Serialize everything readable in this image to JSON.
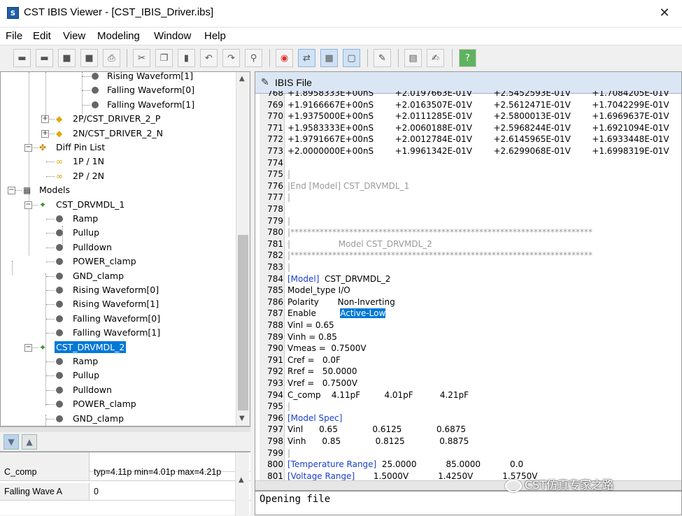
{
  "window": {
    "title": "CST IBIS Viewer - [CST_IBIS_Driver.ibs]",
    "icon_label": "S",
    "close_glyph": "✕"
  },
  "menu": [
    "File",
    "Edit",
    "View",
    "Modeling",
    "Window",
    "Help"
  ],
  "toolbar": {
    "buttons": [
      {
        "name": "open-folder-icon",
        "glyph": "▬"
      },
      {
        "name": "folder-icon",
        "glyph": "▬"
      },
      {
        "name": "save-icon",
        "glyph": "■"
      },
      {
        "name": "save-all-icon",
        "glyph": "■"
      },
      {
        "name": "print-icon",
        "glyph": "⎙"
      },
      {
        "name": "cut-icon",
        "glyph": "✂"
      },
      {
        "name": "copy-icon",
        "glyph": "❐"
      },
      {
        "name": "paste-icon",
        "glyph": "▮"
      },
      {
        "name": "undo-icon",
        "glyph": "↶"
      },
      {
        "name": "redo-icon",
        "glyph": "↷"
      },
      {
        "name": "find-icon",
        "glyph": "⚲"
      },
      {
        "name": "color-wheel-icon",
        "glyph": "◉"
      },
      {
        "name": "sync-icon",
        "glyph": "⇄"
      },
      {
        "name": "grid-icon",
        "glyph": "▦"
      },
      {
        "name": "frame-icon",
        "glyph": "▢"
      },
      {
        "name": "tool-icon",
        "glyph": "✎"
      },
      {
        "name": "table-icon",
        "glyph": "▤"
      },
      {
        "name": "edit-icon",
        "glyph": "✍"
      },
      {
        "name": "help-icon",
        "glyph": "?"
      }
    ]
  },
  "tree": {
    "items": [
      {
        "label": "Rising Waveform[1]",
        "icon": "dot"
      },
      {
        "label": "Falling Waveform[0]",
        "icon": "dot"
      },
      {
        "label": "Falling Waveform[1]",
        "icon": "dot"
      },
      {
        "label": "2P/CST_DRIVER_2_P",
        "icon": "pin",
        "expander": "+"
      },
      {
        "label": "2N/CST_DRIVER_2_N",
        "icon": "pin",
        "expander": "+"
      },
      {
        "label": "Diff Pin List",
        "icon": "diff",
        "expander": "−"
      },
      {
        "label": "1P / 1N",
        "icon": "pair"
      },
      {
        "label": "2P / 2N",
        "icon": "pair"
      },
      {
        "label": "Models",
        "icon": "models",
        "expander": "−"
      },
      {
        "label": "CST_DRVMDL_1",
        "icon": "model",
        "expander": "−"
      },
      {
        "label": "Ramp",
        "icon": "dot"
      },
      {
        "label": "Pullup",
        "icon": "dot"
      },
      {
        "label": "Pulldown",
        "icon": "dot"
      },
      {
        "label": "POWER_clamp",
        "icon": "dot"
      },
      {
        "label": "GND_clamp",
        "icon": "dot"
      },
      {
        "label": "Rising Waveform[0]",
        "icon": "dot"
      },
      {
        "label": "Rising Waveform[1]",
        "icon": "dot"
      },
      {
        "label": "Falling Waveform[0]",
        "icon": "dot"
      },
      {
        "label": "Falling Waveform[1]",
        "icon": "dot"
      },
      {
        "label": "CST_DRVMDL_2",
        "icon": "model",
        "expander": "−",
        "selected": true
      },
      {
        "label": "Ramp",
        "icon": "dot"
      },
      {
        "label": "Pullup",
        "icon": "dot"
      },
      {
        "label": "Pulldown",
        "icon": "dot"
      },
      {
        "label": "POWER_clamp",
        "icon": "dot"
      },
      {
        "label": "GND_clamp",
        "icon": "dot"
      }
    ],
    "scroll_up": "▲",
    "scroll_down": "▼"
  },
  "properties": {
    "sort_desc": "▼",
    "sort_asc": "▲",
    "rows": [
      {
        "name": "",
        "value": ""
      },
      {
        "name": "C_comp",
        "value": "typ=4.11p min=4.01p max=4.21p"
      },
      {
        "name": "Falling Wave A",
        "value": "0"
      }
    ]
  },
  "ibis_file": {
    "tab_label": "IBIS File",
    "tab_icon": "✎",
    "lines": [
      {
        "n": "768",
        "t": "+1.8958333E+00nS        +2.0197663E-01V        +2.5452593E-01V        +1.7084205E-01V"
      },
      {
        "n": "769",
        "t": "+1.9166667E+00nS        +2.0163507E-01V        +2.5612471E-01V        +1.7042299E-01V"
      },
      {
        "n": "770",
        "t": "+1.9375000E+00nS        +2.0111285E-01V        +2.5800013E-01V        +1.6969637E-01V"
      },
      {
        "n": "771",
        "t": "+1.9583333E+00nS        +2.0060188E-01V        +2.5968244E-01V        +1.6921094E-01V"
      },
      {
        "n": "772",
        "t": "+1.9791667E+00nS        +2.0012784E-01V        +2.6145965E-01V        +1.6933448E-01V"
      },
      {
        "n": "773",
        "t": "+2.0000000E+00nS        +1.9961342E-01V        +2.6299068E-01V        +1.6998319E-01V"
      },
      {
        "n": "774",
        "t": ""
      },
      {
        "n": "775",
        "t": "|",
        "style": "gray"
      },
      {
        "n": "776",
        "t": "|End [Model] CST_DRVMDL_1",
        "style": "gray"
      },
      {
        "n": "777",
        "t": "|",
        "style": "gray"
      },
      {
        "n": "778",
        "t": ""
      },
      {
        "n": "779",
        "t": "|",
        "style": "gray"
      },
      {
        "n": "780",
        "t": "|************************************************************************",
        "style": "gray"
      },
      {
        "n": "781",
        "t": "|                  Model CST_DRVMDL_2",
        "style": "gray"
      },
      {
        "n": "782",
        "t": "|************************************************************************",
        "style": "gray"
      },
      {
        "n": "783",
        "t": "|",
        "style": "gray"
      },
      {
        "n": "784",
        "kw": "[Model]",
        "t": "  CST_DRVMDL_2"
      },
      {
        "n": "785",
        "t": "Model_type I/O"
      },
      {
        "n": "786",
        "t": "Polarity       Non-Inverting"
      },
      {
        "n": "787",
        "t": "Enable         ",
        "hl": "Active-Low"
      },
      {
        "n": "788",
        "t": "Vinl = 0.65"
      },
      {
        "n": "789",
        "t": "Vinh = 0.85"
      },
      {
        "n": "790",
        "t": "Vmeas =  0.7500V"
      },
      {
        "n": "791",
        "t": "Cref =   0.0F"
      },
      {
        "n": "792",
        "t": "Rref =   50.0000"
      },
      {
        "n": "793",
        "t": "Vref =   0.7500V"
      },
      {
        "n": "794",
        "t": "C_comp    4.11pF         4.01pF          4.21pF"
      },
      {
        "n": "795",
        "t": "|",
        "style": "gray"
      },
      {
        "n": "796",
        "kw": "[Model Spec]",
        "t": ""
      },
      {
        "n": "797",
        "t": "Vinl      0.65             0.6125             0.6875"
      },
      {
        "n": "798",
        "t": "Vinh      0.85             0.8125             0.8875"
      },
      {
        "n": "799",
        "t": "|",
        "style": "gray"
      },
      {
        "n": "800",
        "kw": "[Temperature Range]",
        "t": "  25.0000           85.0000           0.0"
      },
      {
        "n": "801",
        "kw": "[Voltage Range]",
        "t": "       1.5000V           1.4250V           1.5750V"
      }
    ]
  },
  "output": {
    "text": "Opening file"
  },
  "watermark": {
    "text": "CST仿真专家之路"
  }
}
